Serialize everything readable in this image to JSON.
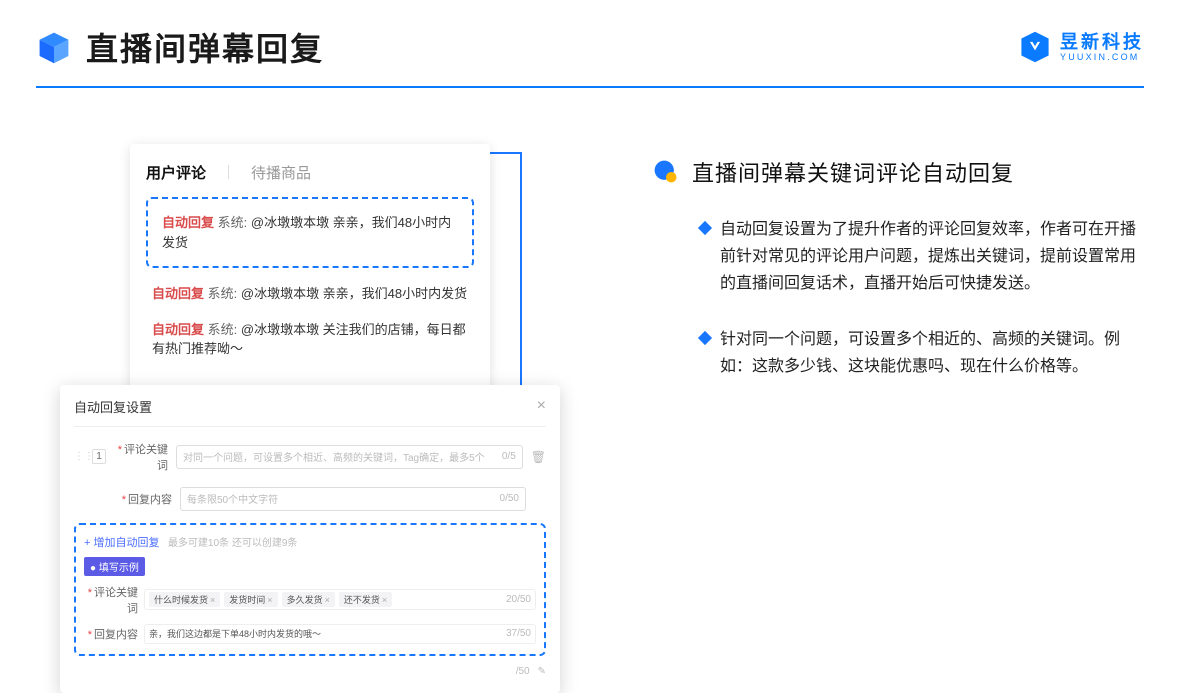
{
  "header": {
    "title": "直播间弹幕回复",
    "brand_cn": "昱新科技",
    "brand_en": "YUUXIN.COM"
  },
  "comment_card": {
    "tab_active": "用户评论",
    "tab_inactive": "待播商品",
    "auto_label": "自动回复",
    "sys_label": "系统:",
    "highlighted": " @冰墩墩本墩 亲亲，我们48小时内发货",
    "line2": " @冰墩墩本墩 亲亲，我们48小时内发货",
    "line3": " @冰墩墩本墩 关注我们的店铺，每日都有热门推荐呦～"
  },
  "modal": {
    "title": "自动回复设置",
    "row_num": "1",
    "label_keyword": "评论关键词",
    "placeholder_keyword": "对同一个问题，可设置多个相近、高频的关键词，Tag确定，最多5个",
    "counter_keyword": "0/5",
    "label_content": "回复内容",
    "placeholder_content": "每条限50个中文字符",
    "counter_content": "0/50",
    "add_link": "+ 增加自动回复",
    "add_hint": "最多可建10条 还可以创建9条",
    "example_badge": "● 填写示例",
    "ex_label_keyword": "评论关键词",
    "ex_tags": [
      "什么时候发货",
      "发货时间",
      "多久发货",
      "还不发货"
    ],
    "ex_counter_keyword": "20/50",
    "ex_label_content": "回复内容",
    "ex_content": "亲，我们这边都是下单48小时内发货的哦～",
    "ex_counter_content": "37/50",
    "bottom_counter": "/50"
  },
  "right": {
    "title": "直播间弹幕关键词评论自动回复",
    "bullet1": "自动回复设置为了提升作者的评论回复效率，作者可在开播前针对常见的评论用户问题，提炼出关键词，提前设置常用的直播间回复话术，直播开始后可快捷发送。",
    "bullet2": "针对同一个问题，可设置多个相近的、高频的关键词。例如：这款多少钱、这块能优惠吗、现在什么价格等。"
  }
}
